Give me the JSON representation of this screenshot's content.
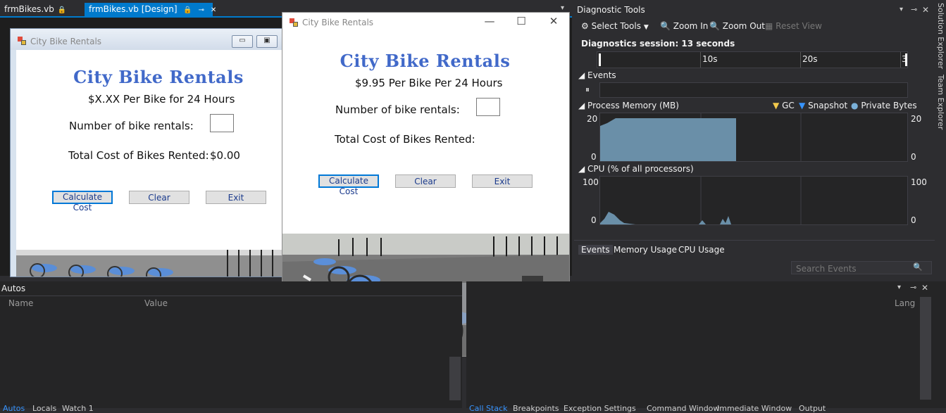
{
  "doc_tabs": [
    {
      "label": "frmBikes.vb",
      "pin": "🔒"
    },
    {
      "label": "frmBikes.vb [Design]",
      "pin": "🔒",
      "pin2": "⊸",
      "close": "✕"
    }
  ],
  "design_form": {
    "window_title": "City Bike Rentals",
    "heading": "City Bike Rentals",
    "price_line": "$X.XX Per Bike for 24 Hours",
    "rentals_label": "Number of bike rentals:",
    "total_label": "Total Cost of Bikes Rented:",
    "total_value": "$0.00",
    "buttons": {
      "calculate": "Calculate Cost",
      "clear": "Clear",
      "exit": "Exit"
    }
  },
  "run_form": {
    "window_title": "City Bike Rentals",
    "heading": "City Bike Rentals",
    "price_line": "$9.95 Per Bike Per 24 Hours",
    "rentals_label": "Number of bike rentals:",
    "total_label": "Total Cost of Bikes Rented:",
    "buttons": {
      "calculate": "Calculate Cost",
      "clear": "Clear",
      "exit": "Exit"
    },
    "controls": {
      "minimize": "—",
      "maximize": "☐",
      "close": "✕"
    }
  },
  "autos": {
    "title": "Autos",
    "columns": [
      "Name",
      "Value"
    ],
    "right_column": "Lang",
    "tabs": [
      "Autos",
      "Locals",
      "Watch 1"
    ],
    "panel_controls": {
      "dropdown": "▾",
      "pin": "⊸",
      "close": "✕"
    }
  },
  "bottom_right_tabs": [
    "Call Stack",
    "Breakpoints",
    "Exception Settings",
    "Command Window",
    "Immediate Window",
    "Output"
  ],
  "diagnostic": {
    "title": "Diagnostic Tools",
    "controls": {
      "dropdown": "▾",
      "pin": "⊸",
      "close": "✕"
    },
    "toolbar": {
      "select_tools": "Select Tools",
      "zoom_in": "Zoom In",
      "zoom_out": "Zoom Out",
      "reset_view": "Reset View"
    },
    "session": "Diagnostics session: 13 seconds",
    "ruler_ticks": [
      "10s",
      "20s",
      "3"
    ],
    "events_label": "Events",
    "memory": {
      "title": "Process Memory (MB)",
      "legend": [
        "GC",
        "Snapshot",
        "Private Bytes"
      ],
      "y_max": "20",
      "y_min": "0",
      "fill_fraction_of_time": 0.5
    },
    "cpu": {
      "title": "CPU (% of all processors)",
      "y_max": "100",
      "y_min": "0"
    },
    "tabs": [
      "Events",
      "Memory Usage",
      "CPU Usage"
    ],
    "search_placeholder": "Search Events",
    "search_icon": "🔍"
  },
  "side_tabs": [
    "Solution Explorer",
    "Team Explorer"
  ],
  "colors": {
    "accent": "#007acc",
    "form_heading": "#4169c9",
    "memory_fill": "#6a8fa8",
    "cpu_fill": "#6a8fa8"
  }
}
